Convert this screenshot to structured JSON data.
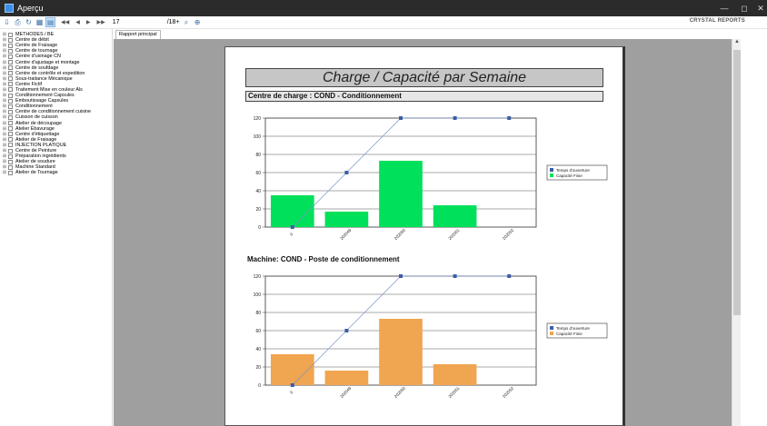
{
  "window": {
    "title": "Aperçu",
    "minimize": "—",
    "maximize": "◻",
    "close": "✕"
  },
  "toolbar": {
    "icons": [
      "export-icon",
      "print-icon",
      "refresh-icon",
      "group-tree-icon",
      "group-tree-active-icon"
    ],
    "nav": {
      "first": "◀◀",
      "prev": "◀",
      "next": "▶",
      "last": "▶▶"
    },
    "page_current": "17",
    "page_total": "/18+",
    "brand": "CRYSTAL REPORTS"
  },
  "tree": {
    "items": [
      "METHODES / BE",
      "Centre de débit",
      "Centre de Fraisage",
      "Centre de tournage",
      "Centre d'usinage CN",
      "Centre d'ajustage et montage",
      "Centre de soufdage",
      "Centre de contrôle et expedition",
      "Sous-traitance Mécanique",
      "Centre Fictif",
      "Traitement Mise en couleur Als",
      "Conditionnement Capsules",
      "Emboutissage Capsules",
      "Conditionnement",
      "Centre de conditionnement cuisine",
      "Cuisson de cuisson",
      "Atelier de découpage",
      "Atelier Ebavurage",
      "Centre d'étiquettage",
      "Atelier de Fraisage",
      "INJECTION PLATIQUE",
      "Centre de Peinture",
      "Préparation ingrédients",
      "Atelier de soudure",
      "Machine Standard",
      "Atelier de Tournage"
    ]
  },
  "tab": {
    "label": "Rapport principal"
  },
  "report": {
    "title": "Charge / Capacité par Semaine",
    "section": "Centre de charge : COND - Conditionnement",
    "machine": "Machine: COND - Poste de conditionnement"
  },
  "chart_data": [
    {
      "type": "bar",
      "categories": [
        "0",
        "202049",
        "202050",
        "202051",
        "202052"
      ],
      "ylim": [
        0,
        120
      ],
      "yticks": [
        0,
        20,
        40,
        60,
        80,
        100,
        120
      ],
      "grid": true,
      "legend_position": "right",
      "series": [
        {
          "name": "Temps d'ouverture",
          "kind": "line",
          "color": "#3b5ea8",
          "values": [
            0,
            60,
            120,
            120,
            120
          ]
        },
        {
          "name": "Capacité Finie",
          "kind": "bar",
          "color": "#00e05a",
          "values": [
            35,
            17,
            73,
            24,
            0
          ]
        }
      ]
    },
    {
      "type": "bar",
      "categories": [
        "0",
        "202049",
        "202050",
        "202051",
        "202052"
      ],
      "ylim": [
        0,
        120
      ],
      "yticks": [
        0,
        20,
        40,
        60,
        80,
        100,
        120
      ],
      "grid": true,
      "legend_position": "right",
      "series": [
        {
          "name": "Temps d'ouverture",
          "kind": "line",
          "color": "#3b5ea8",
          "values": [
            0,
            60,
            120,
            120,
            120
          ]
        },
        {
          "name": "Capacité Finie",
          "kind": "bar",
          "color": "#f0a550",
          "values": [
            34,
            16,
            73,
            23,
            0
          ]
        }
      ]
    }
  ]
}
